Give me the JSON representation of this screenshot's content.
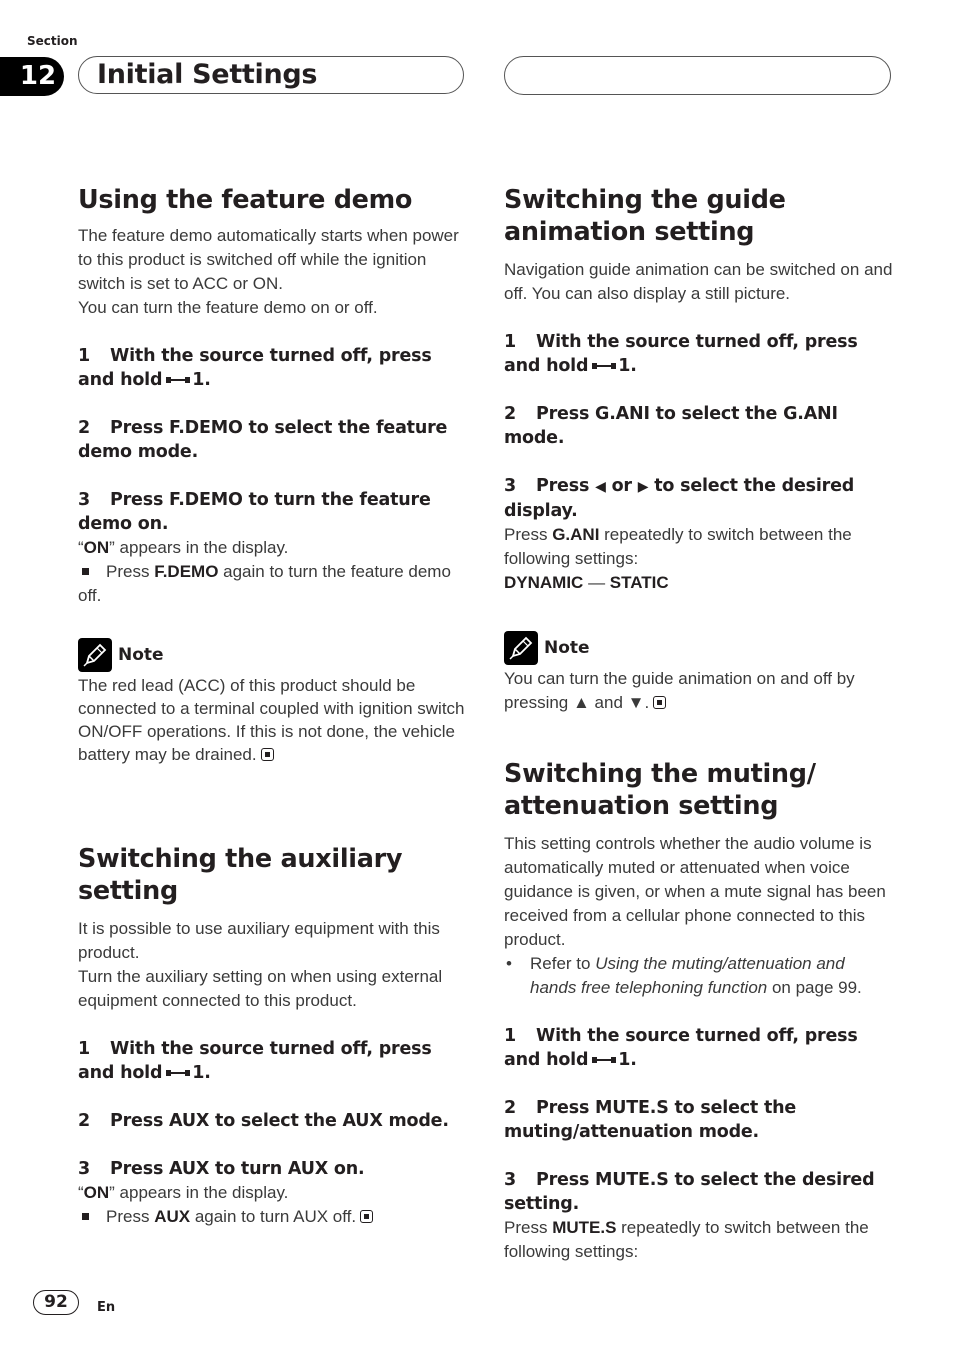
{
  "header": {
    "section_label": "Section",
    "section_number": "12",
    "title": "Initial Settings"
  },
  "left": {
    "feature_demo": {
      "heading": "Using the feature demo",
      "intro": "The feature demo automatically starts when power to this product is switched off while the ignition switch is set to ACC or ON.",
      "intro2": "You can turn the feature demo on or off.",
      "step1_num": "1",
      "step1_a": "With the source turned off, press and hold",
      "step1_b": "1.",
      "step2_num": "2",
      "step2": "Press F.DEMO to select the feature demo mode.",
      "step3_num": "3",
      "step3": "Press F.DEMO to turn the feature demo on.",
      "on_open": "“",
      "on_word": "ON",
      "on_rest": "” appears in the display.",
      "off_pre": "Press ",
      "off_key": "F.DEMO",
      "off_post": " again to turn the feature demo off.",
      "note_label": "Note",
      "note_text": "The red lead (ACC) of this product should be connected to a terminal coupled with ignition switch ON/OFF operations. If this is not done, the vehicle battery may be drained."
    },
    "auxiliary": {
      "heading": "Switching the auxiliary setting",
      "intro": "It is possible to use auxiliary equipment with this product.",
      "intro2": "Turn the auxiliary setting on when using external equipment connected to this product.",
      "step1_num": "1",
      "step1_a": "With the source turned off, press and hold",
      "step1_b": "1.",
      "step2_num": "2",
      "step2": "Press AUX to select the AUX mode.",
      "step3_num": "3",
      "step3": "Press AUX to turn AUX on.",
      "on_open": "“",
      "on_word": "ON",
      "on_rest": "” appears in the display.",
      "off_pre": "Press ",
      "off_key": "AUX",
      "off_post": " again to turn AUX off."
    }
  },
  "right": {
    "guide_animation": {
      "heading": "Switching the guide animation setting",
      "intro": "Navigation guide animation can be switched on and off. You can also display a still picture.",
      "step1_num": "1",
      "step1_a": "With the source turned off, press and hold",
      "step1_b": "1.",
      "step2_num": "2",
      "step2": "Press G.ANI to select the G.ANI mode.",
      "step3_num": "3",
      "step3_a": "Press",
      "step3_left": "◀",
      "step3_or": "or",
      "step3_right": "▶",
      "step3_b": "to select the desired display.",
      "press_pre": "Press ",
      "press_key": "G.ANI",
      "press_post": " repeatedly to switch between the following settings:",
      "setting_a": "DYNAMIC",
      "setting_sep": " — ",
      "setting_b": "STATIC",
      "note_label": "Note",
      "note_text_a": "You can turn the guide animation on and off by pressing ",
      "note_up": "▲",
      "note_and": " and ",
      "note_down": "▼",
      "note_end": "."
    },
    "muting": {
      "heading": "Switching the muting/ attenuation setting",
      "intro": "This setting controls whether the audio volume is automatically muted or attenuated when voice guidance is given, or when a mute signal has been received from a cellular phone connected to this product.",
      "bullet": "•",
      "ref_pre": "Refer to ",
      "ref_italic": "Using the muting/attenuation and hands free telephoning function",
      "ref_post": " on page 99.",
      "step1_num": "1",
      "step1_a": "With the source turned off, press and hold",
      "step1_b": "1.",
      "step2_num": "2",
      "step2": "Press MUTE.S to select the muting/attenuation mode.",
      "step3_num": "3",
      "step3": "Press MUTE.S to select the desired setting.",
      "press_pre": "Press ",
      "press_key": "MUTE.S",
      "press_post": " repeatedly to switch between the following settings:"
    }
  },
  "footer": {
    "page_number": "92",
    "language": "En"
  }
}
